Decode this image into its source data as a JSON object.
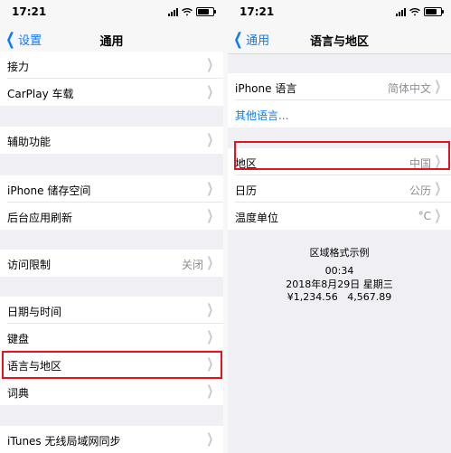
{
  "left": {
    "time": "17:21",
    "back_label": "设置",
    "title": "通用",
    "rows": [
      {
        "label": "接力"
      },
      {
        "label": "CarPlay 车载"
      },
      {
        "label": "辅助功能"
      },
      {
        "label": "iPhone 储存空间"
      },
      {
        "label": "后台应用刷新"
      },
      {
        "label": "访问限制",
        "value": "关闭"
      },
      {
        "label": "日期与时间"
      },
      {
        "label": "键盘"
      },
      {
        "label": "语言与地区"
      },
      {
        "label": "词典"
      },
      {
        "label": "iTunes 无线局域网同步"
      }
    ]
  },
  "right": {
    "time": "17:21",
    "back_label": "通用",
    "title": "语言与地区",
    "language_row": {
      "label": "iPhone 语言",
      "value": "简体中文"
    },
    "other_languages": "其他语言...",
    "region_row": {
      "label": "地区",
      "value": "中国"
    },
    "calendar_row": {
      "label": "日历",
      "value": "公历"
    },
    "temperature_row": {
      "label": "温度单位",
      "value": "°C"
    },
    "format_preview": {
      "heading": "区域格式示例",
      "time": "00:34",
      "date": "2018年8月29日 星期三",
      "numbers": "¥1,234.56   4,567.89"
    }
  },
  "colors": {
    "accent": "#0a7aff",
    "highlight": "#e4131c"
  }
}
